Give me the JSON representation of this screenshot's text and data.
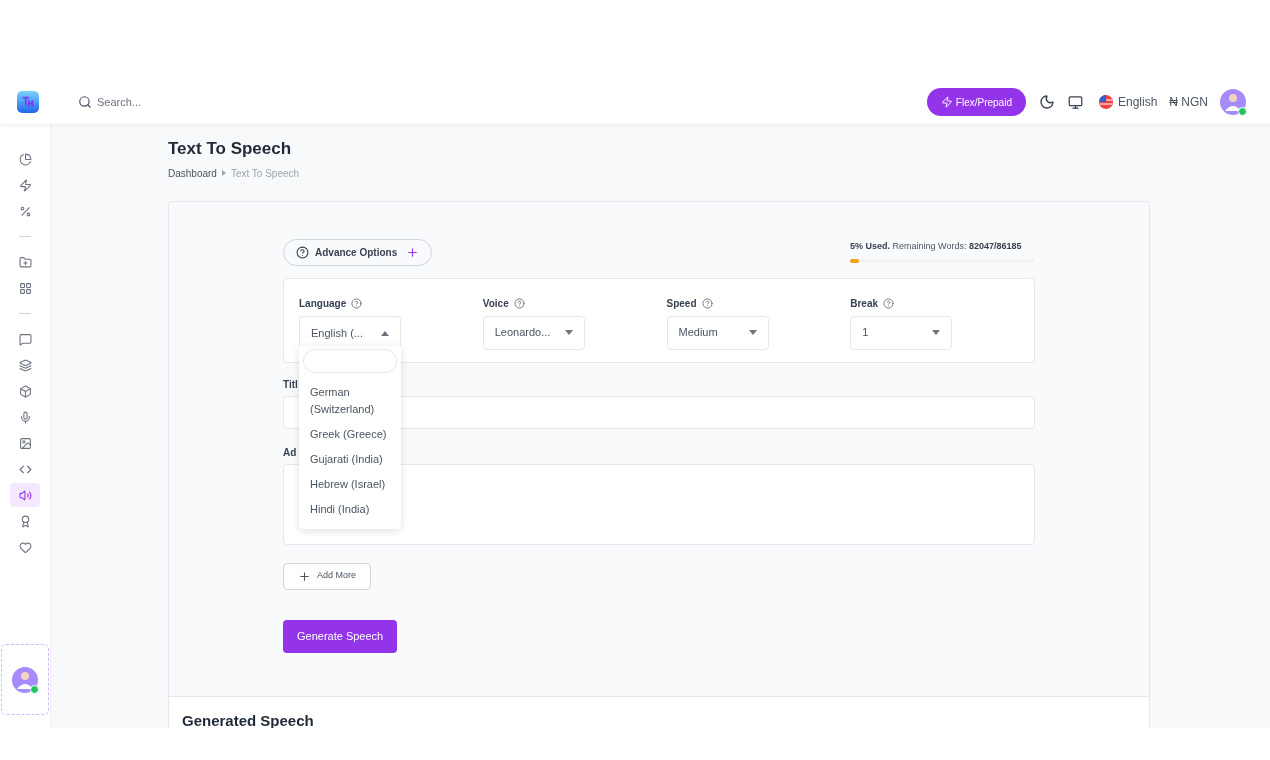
{
  "header": {
    "search": {
      "placeholder": "Search..."
    },
    "plan_button": "Flex/Prepaid",
    "language": "English",
    "currency": "₦ NGN",
    "avatar_online": true
  },
  "sidebar": {
    "groups": [
      [
        {
          "selected": false
        },
        {
          "selected": false
        },
        {
          "selected": false
        }
      ],
      [
        {
          "selected": false
        },
        {
          "selected": false
        }
      ],
      [
        {
          "selected": false
        },
        {
          "selected": false
        },
        {
          "selected": false
        },
        {
          "selected": false
        },
        {
          "selected": false
        },
        {
          "selected": false
        },
        {
          "selected": true
        },
        {
          "selected": false
        },
        {
          "selected": false
        }
      ]
    ],
    "avatar_online": true
  },
  "page": {
    "title": "Text To Speech",
    "breadcrumb": [
      {
        "label": "Dashboard",
        "current": false
      },
      {
        "label": "Text To Speech",
        "current": true
      }
    ]
  },
  "form": {
    "advance_options": "Advance Options",
    "usage": {
      "used": "5% Used.",
      "remaining_label": "Remaining Words:",
      "remaining": "82047/86185",
      "level": 0.05
    },
    "selects": [
      {
        "label": "Language",
        "value": "English (...",
        "open": true
      },
      {
        "label": "Voice",
        "value": "Leonardo...",
        "open": false
      },
      {
        "label": "Speed",
        "value": "Medium",
        "open": false
      },
      {
        "label": "Break",
        "value": "1",
        "open": false
      }
    ],
    "dropdown_options": [
      "German (Switzerland)",
      "Greek (Greece)",
      "Gujarati (India)",
      "Hebrew (Israel)",
      "Hindi (India)"
    ],
    "title_label": "Titl",
    "text_label": "Ad",
    "add_more": "Add More",
    "generate": "Generate Speech"
  },
  "generated_section": {
    "title": "Generated Speech"
  }
}
